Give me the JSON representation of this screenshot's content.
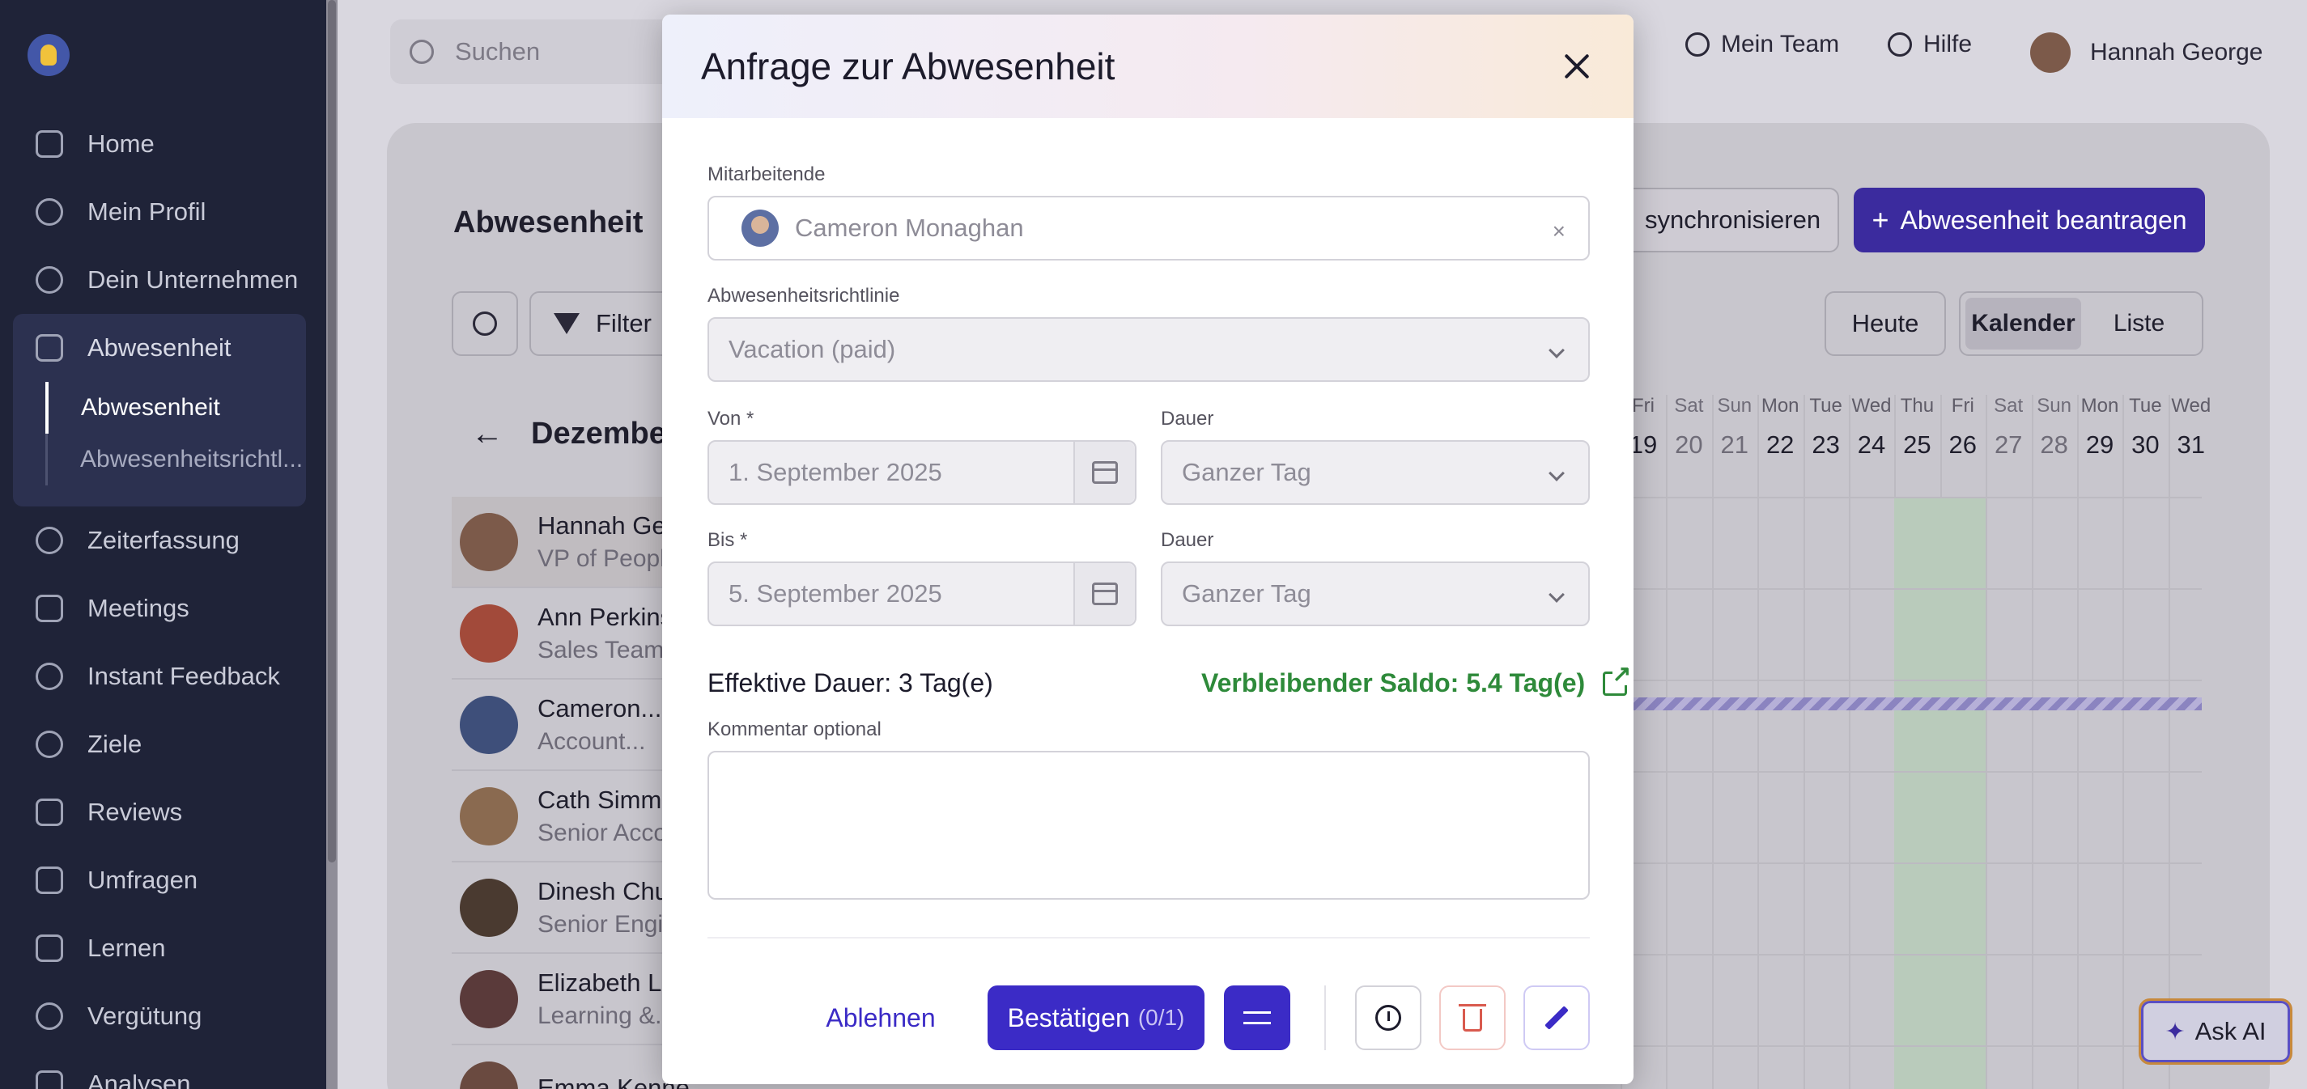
{
  "sidebar": {
    "items": [
      {
        "label": "Home",
        "icon": "home-icon"
      },
      {
        "label": "Mein Profil",
        "icon": "user-icon"
      },
      {
        "label": "Dein Unternehmen",
        "icon": "users-icon"
      },
      {
        "label": "Abwesenheit",
        "icon": "calendar-x-icon"
      },
      {
        "label": "Zeiterfassung",
        "icon": "clock-icon"
      },
      {
        "label": "Meetings",
        "icon": "calendar-icon"
      },
      {
        "label": "Instant Feedback",
        "icon": "chat-icon"
      },
      {
        "label": "Ziele",
        "icon": "target-icon"
      },
      {
        "label": "Reviews",
        "icon": "pencil-icon"
      },
      {
        "label": "Umfragen",
        "icon": "pulse-icon"
      },
      {
        "label": "Lernen",
        "icon": "book-icon"
      },
      {
        "label": "Vergütung",
        "icon": "coins-icon"
      },
      {
        "label": "Analysen",
        "icon": "chart-icon"
      }
    ],
    "sub_items": [
      "Abwesenheit",
      "Abwesenheitsrichtl..."
    ]
  },
  "topbar": {
    "search_placeholder": "Suchen",
    "team": "Mein Team",
    "help": "Hilfe",
    "user": "Hannah George"
  },
  "page": {
    "title": "Abwesenheit",
    "sync": "synchronisieren",
    "request": "Abwesenheit beantragen",
    "filter": "Filter",
    "today": "Heute",
    "view_calendar": "Kalender",
    "view_list": "Liste",
    "month": "Dezember"
  },
  "days": [
    {
      "n": "Fri",
      "d": "19"
    },
    {
      "n": "Sat",
      "d": "20"
    },
    {
      "n": "Sun",
      "d": "21"
    },
    {
      "n": "Mon",
      "d": "22"
    },
    {
      "n": "Tue",
      "d": "23"
    },
    {
      "n": "Wed",
      "d": "24"
    },
    {
      "n": "Thu",
      "d": "25"
    },
    {
      "n": "Fri",
      "d": "26"
    },
    {
      "n": "Sat",
      "d": "27"
    },
    {
      "n": "Sun",
      "d": "28"
    },
    {
      "n": "Mon",
      "d": "29"
    },
    {
      "n": "Tue",
      "d": "30"
    },
    {
      "n": "Wed",
      "d": "31"
    }
  ],
  "people": [
    {
      "name": "Hannah Geo",
      "role": "VP of People",
      "avatar": "#7c5a4a"
    },
    {
      "name": "Ann Perkins",
      "role": "Sales Team L",
      "avatar": "#a24a3a"
    },
    {
      "name": "Cameron...",
      "role": "Account...",
      "avatar": "#3e4f7a"
    },
    {
      "name": "Cath Simms",
      "role": "Senior Acco",
      "avatar": "#8a6a50"
    },
    {
      "name": "Dinesh Chug",
      "role": "Senior Engin",
      "avatar": "#4a3a30"
    },
    {
      "name": "Elizabeth Le",
      "role": "Learning &...",
      "avatar": "#5a3a3a"
    },
    {
      "name": "Emma Kenne",
      "role": "",
      "avatar": "#6a4a40"
    }
  ],
  "ask_ai": "Ask AI",
  "modal": {
    "title": "Anfrage zur Abwesenheit",
    "employee_label": "Mitarbeitende",
    "employee_value": "Cameron Monaghan",
    "policy_label": "Abwesenheitsrichtlinie",
    "policy_value": "Vacation (paid)",
    "from_label": "Von *",
    "from_value": "1. September 2025",
    "from_duration_label": "Dauer",
    "from_duration_value": "Ganzer Tag",
    "to_label": "Bis *",
    "to_value": "5. September 2025",
    "to_duration_label": "Dauer",
    "to_duration_value": "Ganzer Tag",
    "effective": "Effektive Dauer: 3 Tag(e)",
    "remaining": "Verbleibender Saldo: 5.4 Tag(e)",
    "comment_label": "Kommentar optional",
    "reject": "Ablehnen",
    "confirm": "Bestätigen",
    "confirm_count": "(0/1)"
  }
}
